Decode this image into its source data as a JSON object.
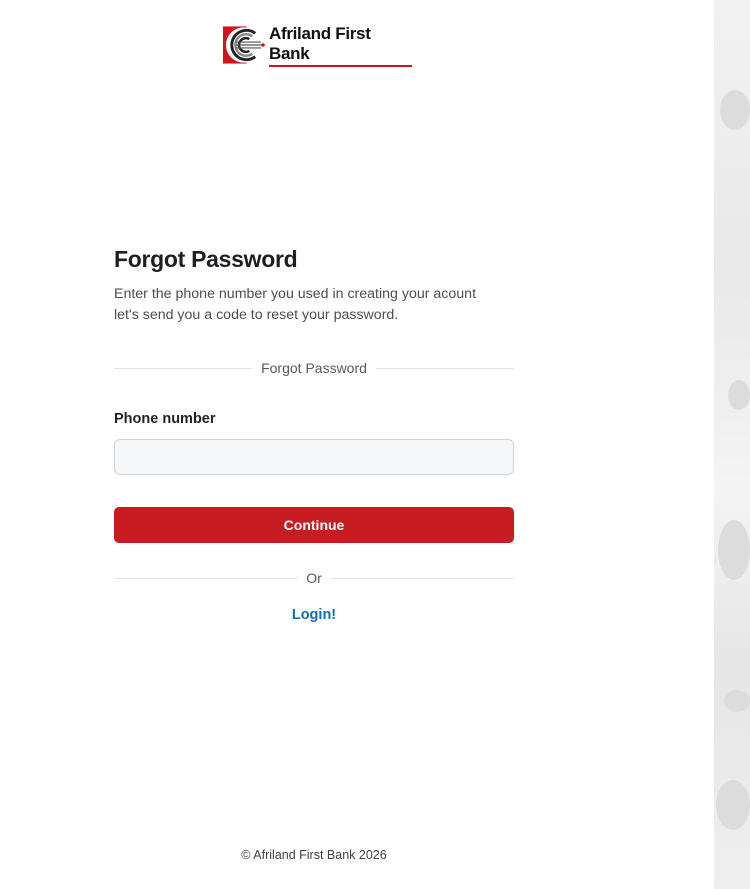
{
  "brand": {
    "name": "Afriland First Bank",
    "accent_color": "#c71c22",
    "link_color": "#0d6fb1"
  },
  "page": {
    "title": "Forgot Password",
    "description_line1": "Enter the phone number you used in creating your acount",
    "description_line2": "let's send you a code to reset your password."
  },
  "form": {
    "section_label": "Forgot Password",
    "phone_label": "Phone number",
    "phone_value": "",
    "phone_placeholder": "",
    "submit_label": "Continue"
  },
  "alt": {
    "separator_label": "Or",
    "login_link": "Login!"
  },
  "footer": {
    "copyright": "© Afriland First Bank 2026"
  },
  "icons": {
    "logo": "afriland-logo-icon"
  }
}
